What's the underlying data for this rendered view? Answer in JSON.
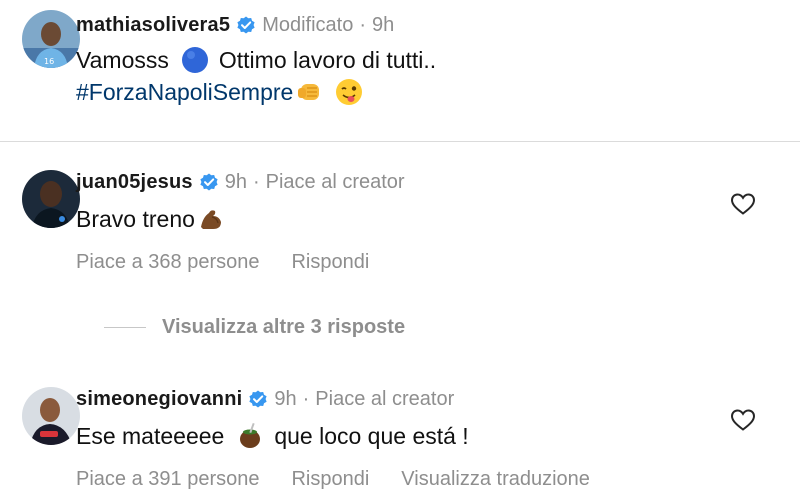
{
  "colors": {
    "verified_blue": "#3897f0",
    "secondary_text": "#8e8e8e",
    "hashtag": "#00376b",
    "divider": "#dbdbdb"
  },
  "caption": {
    "username": "mathiasolivera5",
    "edited": "Modificato",
    "time": "9h",
    "line1_a": "Vamosss",
    "line1_emoji": "blue-circle",
    "line1_b": "Ottimo lavoro di tutti..",
    "hashtag": "#ForzaNapoliSempre",
    "emojis": [
      "fist-bump",
      "winking-face-tongue"
    ]
  },
  "comments": [
    {
      "username": "juan05jesus",
      "time": "9h",
      "creator_like": "Piace al creator",
      "text": "Bravo treno",
      "emoji": "flexed-biceps",
      "likes": "Piace a 368 persone",
      "reply": "Rispondi",
      "view_replies": "Visualizza altre 3 risposte"
    },
    {
      "username": "simeonegiovanni",
      "time": "9h",
      "creator_like": "Piace al creator",
      "text_a": "Ese mateeeee",
      "emoji": "mate-gourd",
      "text_b": "que loco que está !",
      "likes": "Piace a 391 persone",
      "reply": "Rispondi",
      "translate": "Visualizza traduzione"
    }
  ]
}
